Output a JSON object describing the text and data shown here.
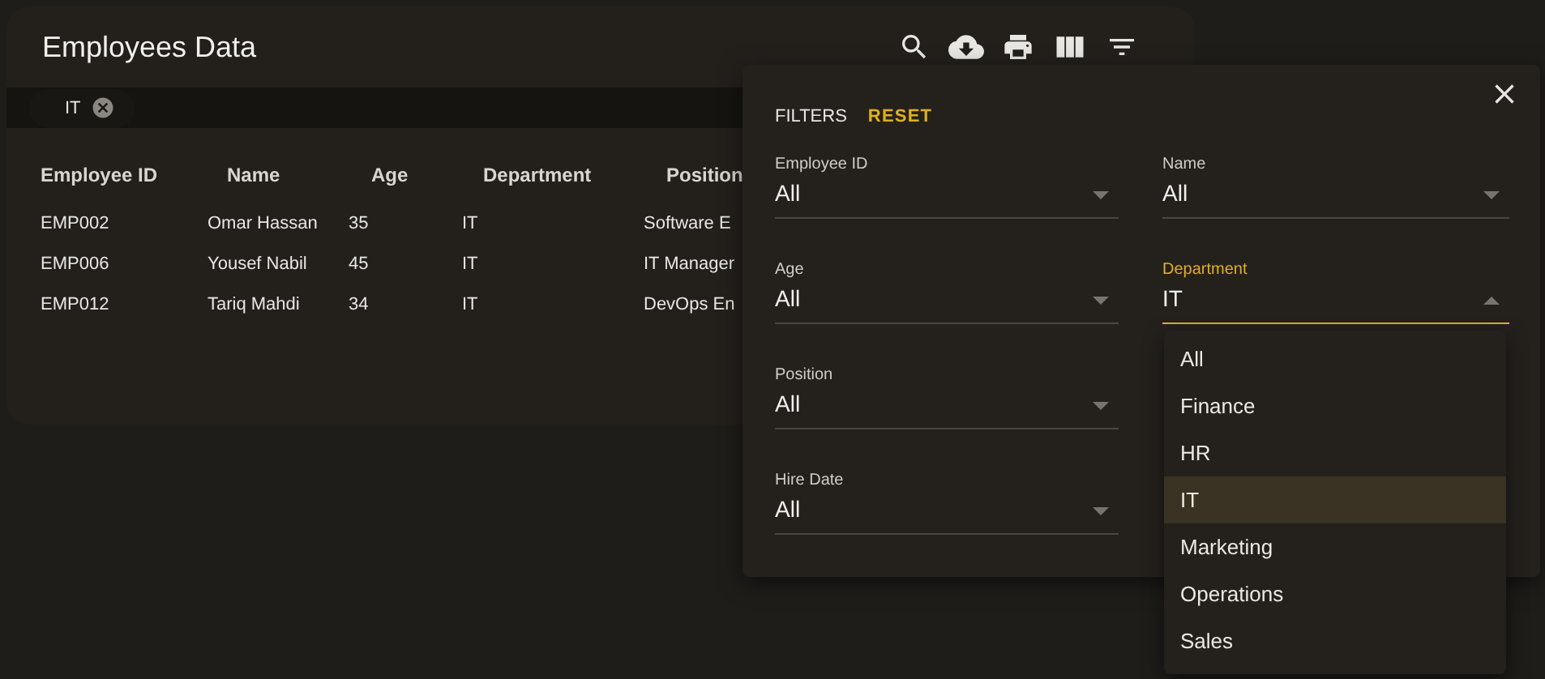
{
  "title": "Employees Data",
  "toolbar": [
    {
      "kind": "search"
    },
    {
      "kind": "download"
    },
    {
      "kind": "print"
    },
    {
      "kind": "columns"
    },
    {
      "kind": "filter"
    }
  ],
  "chips": [
    {
      "label": "IT"
    }
  ],
  "table": {
    "columns": [
      "Employee ID",
      "Name",
      "Age",
      "Department",
      "Position"
    ],
    "rows": [
      [
        "EMP002",
        "Omar Hassan",
        "35",
        "IT",
        "Software E"
      ],
      [
        "EMP006",
        "Yousef Nabil",
        "45",
        "IT",
        "IT Manager"
      ],
      [
        "EMP012",
        "Tariq Mahdi",
        "34",
        "IT",
        "DevOps En"
      ]
    ]
  },
  "filters": {
    "title": "FILTERS",
    "reset": "RESET",
    "columns": [
      {
        "fields": [
          {
            "label": "Employee ID",
            "value": "All",
            "focused": false
          },
          {
            "label": "Age",
            "value": "All",
            "focused": false
          },
          {
            "label": "Position",
            "value": "All",
            "focused": false
          },
          {
            "label": "Hire Date",
            "value": "All",
            "focused": false
          }
        ]
      },
      {
        "fields": [
          {
            "label": "Name",
            "value": "All",
            "focused": false
          },
          {
            "label": "Department",
            "value": "IT",
            "focused": true,
            "options": [
              {
                "label": "All",
                "selected": false
              },
              {
                "label": "Finance",
                "selected": false
              },
              {
                "label": "HR",
                "selected": false
              },
              {
                "label": "IT",
                "selected": true
              },
              {
                "label": "Marketing",
                "selected": false
              },
              {
                "label": "Operations",
                "selected": false
              },
              {
                "label": "Sales",
                "selected": false
              }
            ]
          }
        ]
      }
    ]
  }
}
